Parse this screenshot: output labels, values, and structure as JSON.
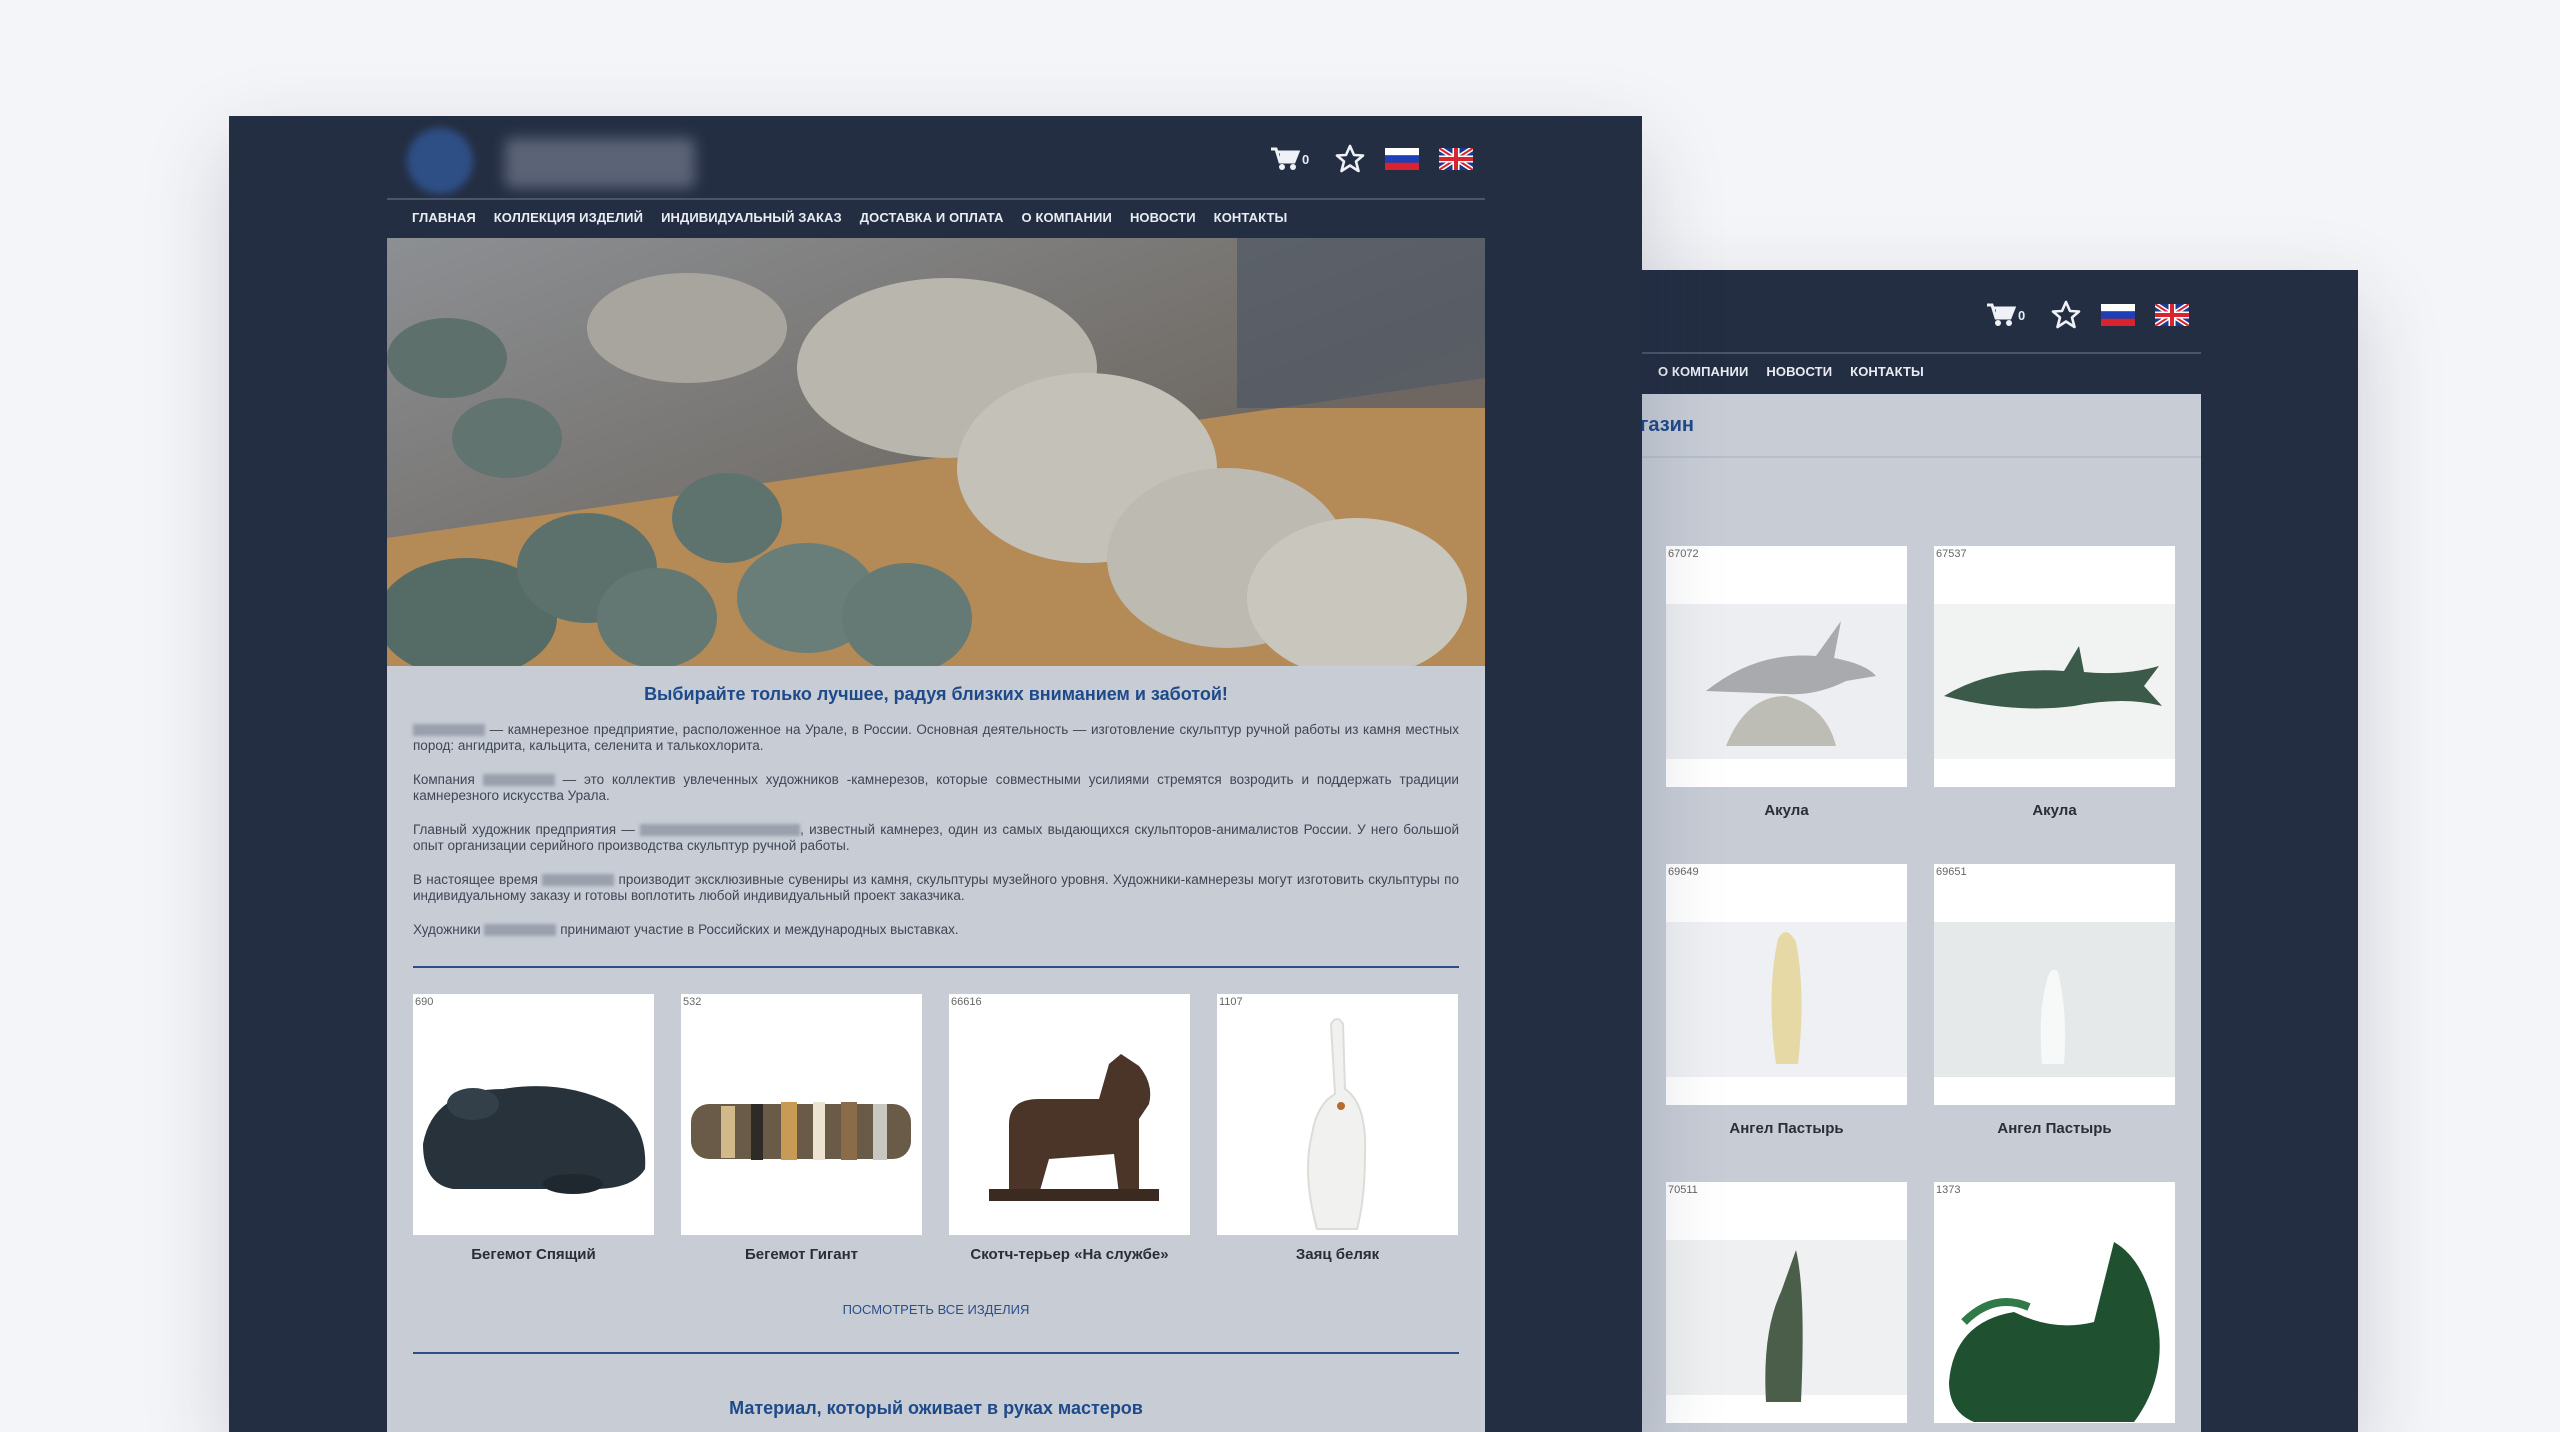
{
  "header": {
    "cart_count": "0",
    "icons": [
      "cart-icon",
      "star-icon",
      "flag-ru-icon",
      "flag-uk-icon"
    ]
  },
  "nav": {
    "items": [
      "ГЛАВНАЯ",
      "КОЛЛЕКЦИЯ ИЗДЕЛИЙ",
      "ИНДИВИДУАЛЬНЫЙ ЗАКАЗ",
      "ДОСТАВКА И ОПЛАТА",
      "О КОМПАНИИ",
      "НОВОСТИ",
      "КОНТАКТЫ"
    ]
  },
  "front": {
    "headline": "Выбирайте только лучшее, радуя близких вниманием и заботой!",
    "paragraphs": {
      "p1_a": "— камнерезное предприятие, расположенное на Урале, в России.  Основная деятельность — изготовление скульптур ручной работы из камня местных пород: ангидрита, кальцита, селенита и талькохлорита.",
      "p2_a": "Компания",
      "p2_b": "— это коллектив увлеченных художников -камнерезов, которые совместными усилиями стремятся возродить и поддержать традиции камнерезного искусства Урала.",
      "p3_a": "Главный художник предприятия —",
      "p3_b": ", известный камнерез, один из самых выдающихся скульпторов-анималистов России. У него большой опыт организации серийного производства скульптур ручной работы.",
      "p4_a": "В настоящее время",
      "p4_b": "производит эксклюзивные сувениры из камня, скульптуры музейного уровня. Художники-камнерезы могут изготовить скульптуры по индивидуальному заказу и готовы воплотить любой индивидуальный проект заказчика.",
      "p5_a": "Художники",
      "p5_b": "принимают участие в Российских и международных выставках."
    },
    "products": [
      {
        "code": "690",
        "title": "Бегемот Спящий"
      },
      {
        "code": "532",
        "title": "Бегемот Гигант"
      },
      {
        "code": "66616",
        "title": "Скотч-терьер «На службе»"
      },
      {
        "code": "1107",
        "title": "Заяц беляк"
      }
    ],
    "see_all": "ПОСМОТРЕТЬ ВСЕ ИЗДЕЛИЯ",
    "section2_title": "Материал, который оживает в руках мастеров"
  },
  "back": {
    "nav_items": [
      "О КОМПАНИИ",
      "НОВОСТИ",
      "КОНТАКТЫ"
    ],
    "shop_title": "газин",
    "products": [
      {
        "code": "67072",
        "title": "Акула"
      },
      {
        "code": "67537",
        "title": "Акула"
      },
      {
        "code": "69649",
        "title": "Ангел Пастырь"
      },
      {
        "code": "69651",
        "title": "Ангел Пастырь"
      },
      {
        "code": "70511",
        "title": ""
      },
      {
        "code": "1373",
        "title": ""
      }
    ]
  },
  "colors": {
    "header_bg": "#242e43",
    "panel_bg": "#c7ccd5",
    "accent_blue": "#1f4a8a",
    "page_bg": "#f4f5f8"
  }
}
